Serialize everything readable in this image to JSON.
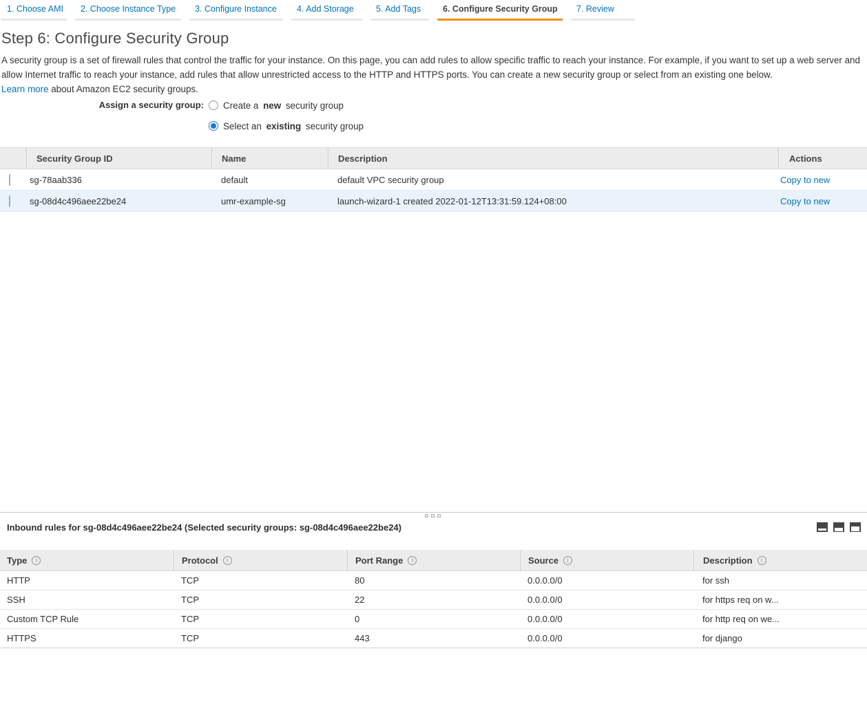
{
  "tabs": [
    {
      "label": "1. Choose AMI"
    },
    {
      "label": "2. Choose Instance Type"
    },
    {
      "label": "3. Configure Instance"
    },
    {
      "label": "4. Add Storage"
    },
    {
      "label": "5. Add Tags"
    },
    {
      "label": "6. Configure Security Group"
    },
    {
      "label": "7. Review"
    }
  ],
  "heading": "Step 6: Configure Security Group",
  "intro": {
    "body": "A security group is a set of firewall rules that control the traffic for your instance. On this page, you can add rules to allow specific traffic to reach your instance. For example, if you want to set up a web server and allow Internet traffic to reach your instance, add rules that allow unrestricted access to the HTTP and HTTPS ports. You can create a new security group or select from an existing one below.",
    "learn_more": "Learn more",
    "learn_more_suffix": " about Amazon EC2 security groups."
  },
  "assign": {
    "label": "Assign a security group:",
    "options": [
      {
        "pre": "Create a",
        "bold": "new",
        "post": "security group",
        "selected": false
      },
      {
        "pre": "Select an",
        "bold": "existing",
        "post": "security group",
        "selected": true
      }
    ]
  },
  "sg_table": {
    "headers": {
      "id": "Security Group ID",
      "name": "Name",
      "description": "Description",
      "actions": "Actions"
    },
    "rows": [
      {
        "id": "sg-78aab336",
        "name": "default",
        "description": "default VPC security group",
        "action": "Copy to new",
        "checked": false
      },
      {
        "id": "sg-08d4c496aee22be24",
        "name": "umr-example-sg",
        "description": "launch-wizard-1 created 2022-01-12T13:31:59.124+08:00",
        "action": "Copy to new",
        "checked": true
      }
    ]
  },
  "inbound": {
    "title": "Inbound rules for sg-08d4c496aee22be24 (Selected security groups: sg-08d4c496aee22be24)",
    "headers": {
      "type": "Type",
      "protocol": "Protocol",
      "port_range": "Port Range",
      "source": "Source",
      "description": "Description"
    },
    "rows": [
      {
        "type": "HTTP",
        "protocol": "TCP",
        "port": "80",
        "source": "0.0.0.0/0",
        "description": "for ssh"
      },
      {
        "type": "SSH",
        "protocol": "TCP",
        "port": "22",
        "source": "0.0.0.0/0",
        "description": "for https req on w..."
      },
      {
        "type": "Custom TCP Rule",
        "protocol": "TCP",
        "port": "0",
        "source": "0.0.0.0/0",
        "description": "for http req on we..."
      },
      {
        "type": "HTTPS",
        "protocol": "TCP",
        "port": "443",
        "source": "0.0.0.0/0",
        "description": "for django"
      }
    ]
  },
  "colors": {
    "accent_orange": "#ee8f12",
    "link_blue": "#0073bb",
    "selected_row_bg": "#eaf3fb",
    "checkbox_blue": "#2878be",
    "radio_blue": "#1f7bce",
    "table_header_bg": "#ececec"
  }
}
